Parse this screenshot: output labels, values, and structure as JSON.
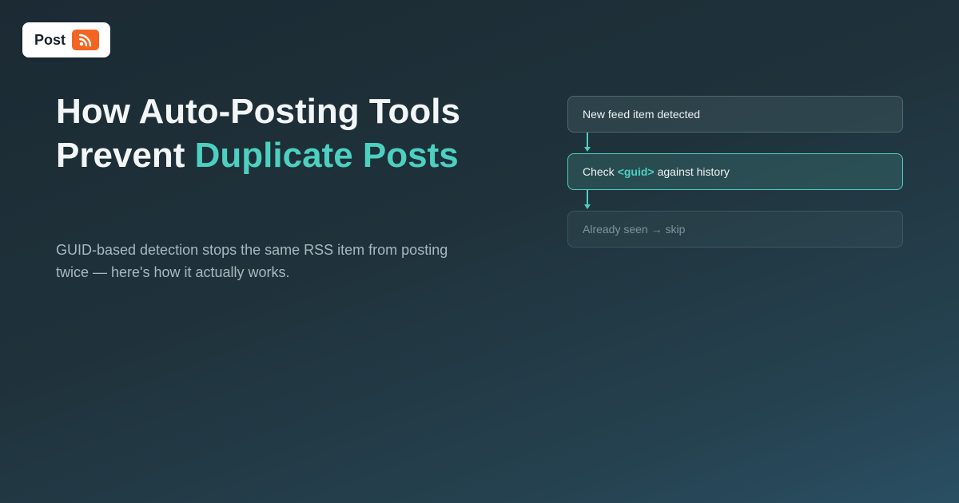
{
  "brand": {
    "name": "Post",
    "icon": "rss-icon",
    "icon_color": "#f26522"
  },
  "headline": {
    "part1": "How Auto-Posting Tools",
    "part2": "Prevent ",
    "accent": "Duplicate Posts"
  },
  "subtitle": "GUID-based detection stops the same RSS item from posting twice — here's how it actually works.",
  "flow": {
    "step1": "New feed item detected",
    "step2_prefix": "Check",
    "step2_code": "<guid>",
    "step2_suffix": "against history",
    "step3": "Already seen → skip"
  },
  "colors": {
    "accent": "#4dd0c0",
    "background_start": "#1b2a33",
    "background_end": "#2a4f63"
  }
}
